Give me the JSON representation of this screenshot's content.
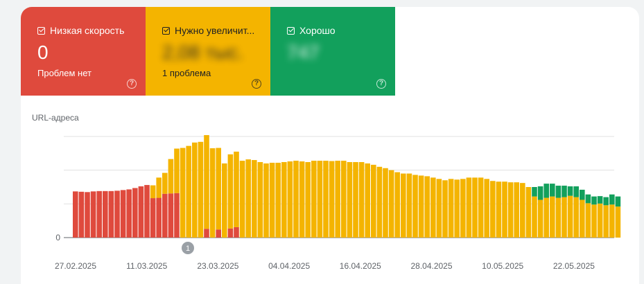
{
  "tiles": [
    {
      "label": "Низкая скорость",
      "value": "0",
      "sub": "Проблем нет",
      "help": "?"
    },
    {
      "label": "Нужно увеличит...",
      "value": "2,08 тыс.",
      "sub": "1 проблема",
      "help": "?"
    },
    {
      "label": "Хорошо",
      "value": "747",
      "sub": "",
      "help": "?"
    }
  ],
  "colors": {
    "red": "#df4a3d",
    "yellow": "#f4b400",
    "green": "#12a05c"
  },
  "chart_data": {
    "type": "bar",
    "stacked": true,
    "ylabel": "URL-адреса",
    "y_tick_labels": [
      "0"
    ],
    "ylim": [
      0,
      3
    ],
    "grid": true,
    "annotation": "1",
    "x_tick_labels": [
      "27.02.2025",
      "11.03.2025",
      "23.03.2025",
      "04.04.2025",
      "16.04.2025",
      "28.04.2025",
      "10.05.2025",
      "22.05.2025"
    ],
    "series": [
      {
        "name": "Низкая скорость",
        "color": "#df4a3d",
        "values": [
          1.37,
          1.36,
          1.35,
          1.37,
          1.38,
          1.38,
          1.38,
          1.39,
          1.41,
          1.43,
          1.47,
          1.52,
          1.56,
          1.17,
          1.18,
          1.3,
          1.31,
          1.32,
          0,
          0,
          0,
          0,
          0.26,
          0,
          0.24,
          0,
          0.27,
          0.31,
          0,
          0,
          0,
          0,
          0,
          0,
          0,
          0,
          0,
          0,
          0,
          0,
          0,
          0,
          0,
          0,
          0,
          0,
          0,
          0,
          0,
          0,
          0,
          0,
          0,
          0,
          0,
          0,
          0,
          0,
          0,
          0,
          0,
          0,
          0,
          0,
          0,
          0,
          0,
          0,
          0,
          0,
          0,
          0,
          0,
          0,
          0,
          0,
          0,
          0,
          0,
          0,
          0,
          0,
          0,
          0,
          0,
          0,
          0,
          0,
          0,
          0,
          0,
          0
        ]
      },
      {
        "name": "Нужно увеличить",
        "color": "#f4b400",
        "values": [
          0,
          0,
          0,
          0,
          0,
          0,
          0,
          0,
          0,
          0,
          0,
          0,
          0,
          0.38,
          0.6,
          0.62,
          1.02,
          1.32,
          2.66,
          2.72,
          2.82,
          2.84,
          2.78,
          2.65,
          2.42,
          2.2,
          2.2,
          2.24,
          2.28,
          2.32,
          2.3,
          2.24,
          2.2,
          2.22,
          2.22,
          2.24,
          2.26,
          2.28,
          2.26,
          2.24,
          2.28,
          2.28,
          2.28,
          2.27,
          2.28,
          2.28,
          2.24,
          2.24,
          2.24,
          2.2,
          2.16,
          2.1,
          2.06,
          2.0,
          1.94,
          1.9,
          1.9,
          1.86,
          1.84,
          1.82,
          1.78,
          1.74,
          1.7,
          1.74,
          1.72,
          1.74,
          1.78,
          1.78,
          1.78,
          1.74,
          1.68,
          1.66,
          1.66,
          1.64,
          1.64,
          1.62,
          1.5,
          1.22,
          1.12,
          1.18,
          1.22,
          1.18,
          1.2,
          1.24,
          1.2,
          1.12,
          1.02,
          0.98,
          1.01,
          0.96,
          0.98,
          0.92
        ]
      },
      {
        "name": "Хорошо",
        "color": "#12a05c",
        "values": [
          0,
          0,
          0,
          0,
          0,
          0,
          0,
          0,
          0,
          0,
          0,
          0,
          0,
          0,
          0,
          0,
          0,
          0,
          0,
          0,
          0,
          0,
          0,
          0,
          0,
          0,
          0,
          0,
          0,
          0,
          0,
          0,
          0,
          0,
          0,
          0,
          0,
          0,
          0,
          0,
          0,
          0,
          0,
          0,
          0,
          0,
          0,
          0,
          0,
          0,
          0,
          0,
          0,
          0,
          0,
          0,
          0,
          0,
          0,
          0,
          0,
          0,
          0,
          0,
          0,
          0,
          0,
          0,
          0,
          0,
          0,
          0,
          0,
          0,
          0,
          0,
          0,
          0.28,
          0.4,
          0.42,
          0.38,
          0.36,
          0.34,
          0.28,
          0.32,
          0.3,
          0.26,
          0.24,
          0.22,
          0.24,
          0.3,
          0.3
        ]
      }
    ]
  }
}
